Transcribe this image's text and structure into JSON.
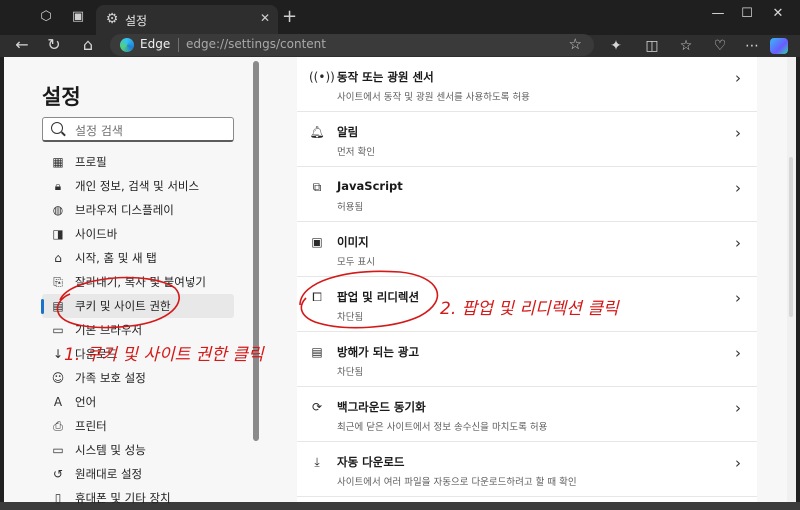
{
  "browser": {
    "tab_title": "설정",
    "brand": "Edge",
    "url": "edge://settings/content"
  },
  "sidebar": {
    "title": "설정",
    "search_placeholder": "설정 검색",
    "items": [
      {
        "label": "프로필",
        "icon": "profile-icon"
      },
      {
        "label": "개인 정보, 검색 및 서비스",
        "icon": "lock-icon"
      },
      {
        "label": "브라우저 디스플레이",
        "icon": "palette-icon"
      },
      {
        "label": "사이드바",
        "icon": "sidebar-icon"
      },
      {
        "label": "시작, 홈 및 새 탭",
        "icon": "home-icon"
      },
      {
        "label": "잘라내기, 복사 및 붙여넣기",
        "icon": "clipboard-icon"
      },
      {
        "label": "쿠키 및 사이트 권한",
        "icon": "cookie-icon"
      },
      {
        "label": "기본 브라우저",
        "icon": "browser-icon"
      },
      {
        "label": "다운로드",
        "icon": "download-icon"
      },
      {
        "label": "가족 보호 설정",
        "icon": "family-icon"
      },
      {
        "label": "언어",
        "icon": "language-icon"
      },
      {
        "label": "프린터",
        "icon": "printer-icon"
      },
      {
        "label": "시스템 및 성능",
        "icon": "system-icon"
      },
      {
        "label": "원래대로 설정",
        "icon": "reset-icon"
      },
      {
        "label": "휴대폰 및 기타 장치",
        "icon": "phone-icon"
      }
    ]
  },
  "content": {
    "rows": [
      {
        "title": "동작 또는 광원 센서",
        "subtitle": "사이트에서 동작 및 광원 센서를 사용하도록 허용",
        "icon": "sensor-icon"
      },
      {
        "title": "알림",
        "subtitle": "먼저 확인",
        "icon": "bell-icon"
      },
      {
        "title": "JavaScript",
        "subtitle": "허용됨",
        "icon": "javascript-icon"
      },
      {
        "title": "이미지",
        "subtitle": "모두 표시",
        "icon": "image-icon"
      },
      {
        "title": "팝업 및 리디렉션",
        "subtitle": "차단됨",
        "icon": "popup-icon"
      },
      {
        "title": "방해가 되는 광고",
        "subtitle": "차단됨",
        "icon": "ads-icon"
      },
      {
        "title": "백그라운드 동기화",
        "subtitle": "최근에 닫은 사이트에서 정보 송수신을 마치도록 허용",
        "icon": "sync-icon"
      },
      {
        "title": "자동 다운로드",
        "subtitle": "사이트에서 여러 파일을 자동으로 다운로드하려고 할 때 확인",
        "icon": "download-icon"
      }
    ]
  },
  "annotations": {
    "step1": "1. 쿠키 및 사이트 권한 클릭",
    "step2": "2. 팝업 및 리디렉션 클릭",
    "color": "#d41919"
  }
}
